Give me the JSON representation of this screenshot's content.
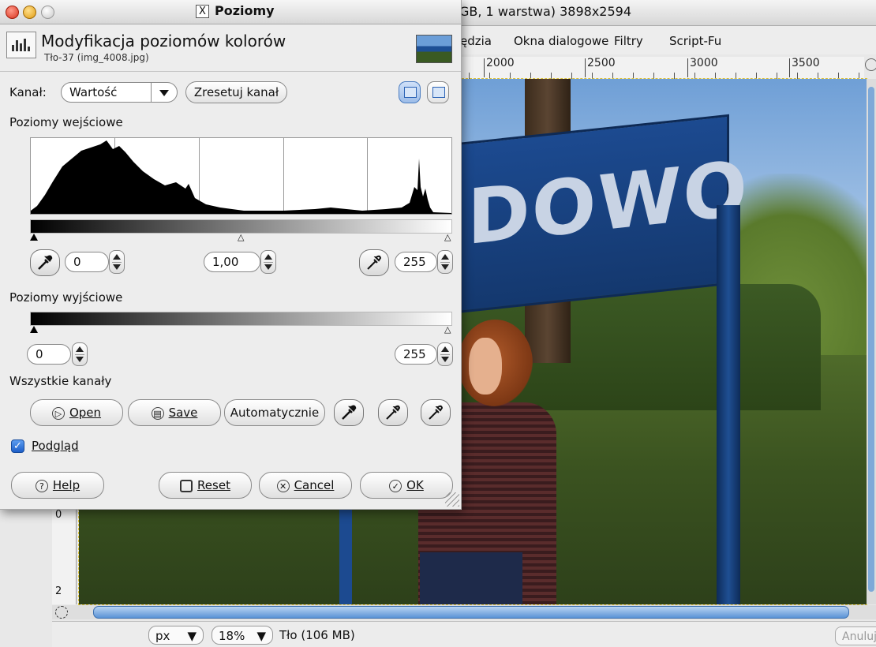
{
  "image_window": {
    "title": "GB, 1 warstwa) 3898x2594",
    "menu": [
      "ędzia",
      "Okna dialogowe",
      "Filtry",
      "Script-Fu"
    ],
    "ruler_labels": [
      "2000",
      "2500",
      "3000",
      "3500"
    ],
    "vruler_labels": [
      "0",
      "2"
    ],
    "sign_text": "DOWO",
    "status": {
      "unit": "px",
      "zoom": "18%",
      "info": "Tło (106 MB)",
      "cancel": "Anuluj"
    }
  },
  "dialog": {
    "window_title": "Poziomy",
    "close_glyph": "X",
    "header_title": "Modyfikacja poziomów kolorów",
    "header_subtitle": "Tło-37 (img_4008.jpg)",
    "channel_label": "Kanał:",
    "channel_value": "Wartość",
    "reset_channel": "Zresetuj kanał",
    "input_levels_label": "Poziomy wejściowe",
    "input_black": "0",
    "input_gamma": "1,00",
    "input_white": "255",
    "output_levels_label": "Poziomy wyjściowe",
    "output_black": "0",
    "output_white": "255",
    "all_channels_label": "Wszystkie kanały",
    "open_label": "Open",
    "save_label": "Save",
    "auto_label": "Automatycznie",
    "preview_label": "Podgląd",
    "preview_checked": true,
    "help_label": "Help",
    "reset_label": "Reset",
    "cancel_label": "Cancel",
    "ok_label": "OK"
  },
  "colors": {
    "accent_blue": "#5a93d6",
    "sign_blue": "#1c4a90",
    "dialog_bg": "#ededed"
  }
}
